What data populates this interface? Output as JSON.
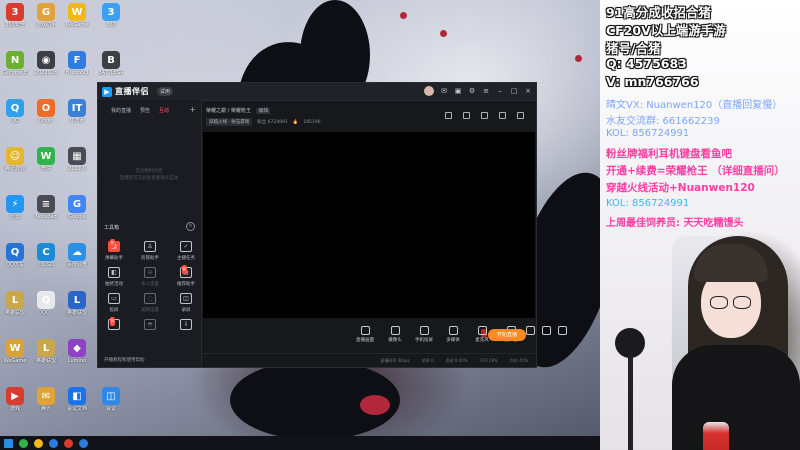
{
  "desktop": {
    "icons": [
      {
        "label": "360安全",
        "color": "#d93b2f",
        "glyph": "3"
      },
      {
        "label": "游戏助手",
        "color": "#e2a23a",
        "glyph": "G"
      },
      {
        "label": "WeGame",
        "color": "#f1b81c",
        "glyph": "W"
      },
      {
        "label": "360",
        "color": "#3aa0f2",
        "glyph": "3"
      },
      {
        "label": "GeForce Experience",
        "color": "#6bb02f",
        "glyph": "N"
      },
      {
        "label": "2022028",
        "color": "#3d3f47",
        "glyph": "◉"
      },
      {
        "label": "FirefoxV3",
        "color": "#2d7de0",
        "glyph": "F"
      },
      {
        "label": "BATTLEGR",
        "color": "#3e3f44",
        "glyph": "B"
      },
      {
        "label": "QQ",
        "color": "#2fa1ea",
        "glyph": "Q"
      },
      {
        "label": "Origin",
        "color": "#f06b2a",
        "glyph": "O"
      },
      {
        "label": "IT技术",
        "color": "#3c7fd6",
        "glyph": "IT"
      },
      {
        "label": "FPS游戏",
        "color": "#b8432f",
        "glyph": "F"
      },
      {
        "label": "腾讯游戏",
        "color": "#e3b82e",
        "glyph": "☺"
      },
      {
        "label": "微信",
        "color": "#2fb34a",
        "glyph": "W"
      },
      {
        "label": "2022-0",
        "color": "#4a4c55",
        "glyph": "▦"
      },
      {
        "label": "K歌",
        "color": "#1d8be8",
        "glyph": "K"
      },
      {
        "label": "迅雷",
        "color": "#2196f3",
        "glyph": "⚡"
      },
      {
        "label": "Notepad",
        "color": "#4a4c55",
        "glyph": "≡"
      },
      {
        "label": "Google",
        "color": "#4285f4",
        "glyph": "G"
      },
      {
        "label": "QQ音乐",
        "color": "#f2c43a",
        "glyph": "♪"
      },
      {
        "label": "QQ飞车",
        "color": "#2573d9",
        "glyph": "Q"
      },
      {
        "label": "CS:GO",
        "color": "#1a8bd6",
        "glyph": "C"
      },
      {
        "label": "百度网盘",
        "color": "#2c8fe8",
        "glyph": "☁"
      },
      {
        "label": "Steam",
        "color": "#15304d",
        "glyph": "S"
      },
      {
        "label": "英雄联盟",
        "color": "#c8a84a",
        "glyph": "L"
      },
      {
        "label": "QQ",
        "color": "#e8e8ea",
        "glyph": "Q"
      },
      {
        "label": "英雄联盟",
        "color": "#2a66c9",
        "glyph": "L"
      },
      {
        "label": "QQ",
        "color": "#e53935",
        "glyph": "Q"
      },
      {
        "label": "WeGame",
        "color": "#d7a43a",
        "glyph": "W"
      },
      {
        "label": "英雄联盟",
        "color": "#c8a84a",
        "glyph": "L"
      },
      {
        "label": "Lumino",
        "color": "#8e43c7",
        "glyph": "◆"
      },
      {
        "label": "League of Legends",
        "color": "#0f3a5c",
        "glyph": "L"
      },
      {
        "label": "游戏",
        "color": "#d93b2f",
        "glyph": "▶"
      },
      {
        "label": "腾讯",
        "color": "#e2a23a",
        "glyph": "✉"
      },
      {
        "label": "会议文档",
        "color": "#1a73e8",
        "glyph": "◧"
      },
      {
        "label": "会议",
        "color": "#2f88e6",
        "glyph": "◫"
      }
    ],
    "taskbar_colors": [
      "#2fb34a",
      "#f1b81c",
      "#2d7de0",
      "#d93b2f",
      "#2d7de0"
    ]
  },
  "app": {
    "title": "直播伴侣",
    "badge": "试用",
    "left_tabs": [
      {
        "label": "我的直播",
        "active": false
      },
      {
        "label": "预告",
        "active": false
      },
      {
        "label": "互动",
        "active": true
      }
    ],
    "add_symbol": "+",
    "empty_text_1": "互动暂时为空",
    "empty_text_2": "直播后可在此处查看观众互动",
    "tools_heading": "工具箱",
    "tools_close": "×",
    "tools": [
      {
        "label": "弹幕助手",
        "glyph": "▣",
        "style": "red",
        "tag": "热"
      },
      {
        "label": "房管助手",
        "glyph": "♙",
        "style": "",
        "tag": ""
      },
      {
        "label": "主播任务",
        "glyph": "✓",
        "style": "",
        "tag": ""
      },
      {
        "label": "抽奖活动",
        "glyph": "◧",
        "style": "",
        "tag": ""
      },
      {
        "label": "多人连麦",
        "glyph": "⊖",
        "style": "dim",
        "tag": ""
      },
      {
        "label": "推荐助手",
        "glyph": "▤",
        "style": "",
        "tag": "新"
      },
      {
        "label": "投屏",
        "glyph": "▭",
        "style": "",
        "tag": ""
      },
      {
        "label": "美颜设置",
        "glyph": "◌",
        "style": "dim",
        "tag": ""
      },
      {
        "label": "录屏",
        "glyph": "◫",
        "style": "",
        "tag": ""
      },
      {
        "label": "",
        "glyph": "⟋",
        "style": "",
        "tag": "热"
      },
      {
        "label": "",
        "glyph": "◓",
        "style": "dim",
        "tag": ""
      },
      {
        "label": "",
        "glyph": "⇩",
        "style": "",
        "tag": ""
      }
    ],
    "bottom_link": "开播教程和使用帮助",
    "stream_title": "荣耀之巅 / 荣耀枪王",
    "stream_title_edit": "编辑",
    "category": "穿越火线 · 射击游戏",
    "meta_fans": "粉丝 6724991",
    "meta_heat": "185196",
    "bottom_tools": [
      "直播画面",
      "摄像头",
      "手机投屏",
      "多媒体",
      "麦克风",
      "扬声器"
    ],
    "start_button": "开始直播",
    "status": [
      "直播码率 0kbps",
      "帧率 0",
      "丢帧 0.00%",
      "CPU 28%",
      "内存 45%"
    ]
  },
  "overlay": {
    "lines_big": [
      "91高分成收招合猪",
      "CF20V以上端游手游",
      "猪号/合猪",
      "Q:  4575683",
      "V:  mn766766"
    ],
    "lines_blue": [
      "晴文VX: Nuanwen120（直播回复慢）",
      "水友交流群: 661662239",
      "KOL: 856724991"
    ],
    "lines_pink": [
      "粉丝牌福利耳机键盘看鱼吧",
      "开通+续费=荣耀枪王  （详细直播问）",
      "穿越火线活动+Nuanwen120"
    ],
    "lines_cyan": [
      "KOL: 856724991",
      "上周最佳饲养员: 天天吃糯馒头"
    ],
    "accent_colors": {
      "pink": "#ff3ea5",
      "cyan": "#37b7ff",
      "blue": "#7ba6ff"
    }
  }
}
